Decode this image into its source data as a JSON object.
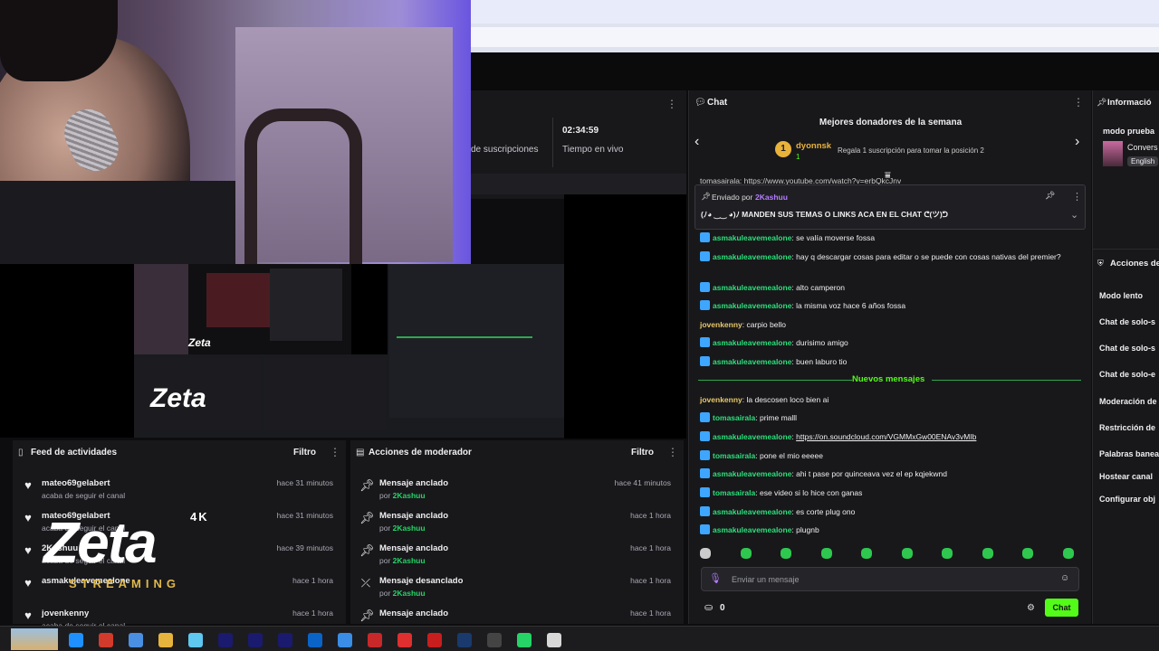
{
  "stats": {
    "subs_label": "de suscripciones",
    "live_time": "02:34:59",
    "live_label": "Tiempo en vivo"
  },
  "feed": {
    "title": "Feed de actividades",
    "filter": "Filtro",
    "items": [
      {
        "name": "mateo69gelabert",
        "sub": "acaba de seguir el canal",
        "time": "hace 31 minutos"
      },
      {
        "name": "mateo69gelabert",
        "sub": "acaba de seguir el canal",
        "time": "hace 31 minutos"
      },
      {
        "name": "2Kashuu",
        "sub": "acaba de seguir el canal",
        "time": "hace 39 minutos"
      },
      {
        "name": "asmakuleavemealone",
        "sub": "",
        "time": "hace 1 hora"
      },
      {
        "name": "jovenkenny",
        "sub": "acaba de seguir el canal",
        "time": "hace 1 hora"
      }
    ]
  },
  "mod": {
    "title": "Acciones de moderador",
    "filter": "Filtro",
    "items": [
      {
        "action": "Mensaje anclado",
        "by": "por",
        "user": "2Kashuu",
        "time": "hace 41 minutos"
      },
      {
        "action": "Mensaje anclado",
        "by": "por",
        "user": "2Kashuu",
        "time": "hace 1 hora"
      },
      {
        "action": "Mensaje anclado",
        "by": "por",
        "user": "2Kashuu",
        "time": "hace 1 hora"
      },
      {
        "action": "Mensaje desanclado",
        "by": "por",
        "user": "2Kashuu",
        "time": "hace 1 hora"
      },
      {
        "action": "Mensaje anclado",
        "by": "por",
        "user": "2Kashuu",
        "time": "hace 1 hora"
      }
    ]
  },
  "chat": {
    "title": "Chat",
    "donors_title": "Mejores donadores de la semana",
    "donor_rank": "1",
    "donor_name": "dyonnsk",
    "donor_amount": "1",
    "gift_text": "Regala 1 suscripción para tomar la posición 2",
    "top_link": "tomasairala: https://www.youtube.com/watch?v=erbQkcJnv",
    "pinned_by": "Enviado por",
    "pinned_user": "2Kashuu",
    "pinned_text": "(ﾉ◕ ‿‿ ◕)ﾉ MANDEN SUS TEMAS O LINKS ACA EN EL CHAT ᕦ(ツ)ᕤ",
    "messages": [
      {
        "user": "asmakuleavemealone",
        "text": ": se valía moverse fossa",
        "badge": true,
        "color": "green"
      },
      {
        "user": "asmakuleavemealone",
        "text": ": hay q descargar cosas para editar o se puede con cosas nativas del premier?",
        "badge": true,
        "color": "green"
      },
      {
        "user": "asmakuleavemealone",
        "text": ": alto camperon",
        "badge": true,
        "color": "green"
      },
      {
        "user": "asmakuleavemealone",
        "text": ": la misma voz hace 6 años fossa",
        "badge": true,
        "color": "green"
      },
      {
        "user": "jovenkenny",
        "text": ": carpio bello",
        "badge": false,
        "color": "yellow"
      },
      {
        "user": "asmakuleavemealone",
        "text": ": durisimo amigo",
        "badge": true,
        "color": "green"
      },
      {
        "user": "asmakuleavemealone",
        "text": ": buen laburo tio",
        "badge": true,
        "color": "green"
      }
    ],
    "new_messages": "Nuevos mensajes",
    "new": [
      {
        "user": "jovenkenny",
        "text": ": la descosen loco bien ai",
        "badge": false,
        "color": "yellow"
      },
      {
        "user": "tomasairala",
        "text": ": prime malll",
        "badge": true,
        "color": "green"
      },
      {
        "user": "asmakuleavemealone",
        "text": ": ",
        "link": "https://on.soundcloud.com/VGMMxGw00ENAv3vMIb",
        "badge": true,
        "color": "green"
      },
      {
        "user": "tomasairala",
        "text": ": pone el mio eeeee",
        "badge": true,
        "color": "green"
      },
      {
        "user": "asmakuleavemealone",
        "text": ": ahi t pase por quinceava vez el ep kqjekwnd",
        "badge": true,
        "color": "green"
      },
      {
        "user": "tomasairala",
        "text": ": ese video si lo hice con ganas",
        "badge": true,
        "color": "green"
      },
      {
        "user": "asmakuleavemealone",
        "text": ": es corte plug ono",
        "badge": true,
        "color": "green"
      },
      {
        "user": "asmakuleavemealone",
        "text": ": plugnb",
        "badge": true,
        "color": "green"
      }
    ],
    "input_placeholder": "Enviar un mensaje",
    "points": "0",
    "send": "Chat"
  },
  "info": {
    "title": "Informació",
    "mode": "modo prueba",
    "conv": "Convers",
    "lang": "English"
  },
  "actions": {
    "title": "Acciones de",
    "items": [
      "Modo lento",
      "Chat de solo-s",
      "Chat de solo-s",
      "Chat de solo-e",
      "Moderación de",
      "Restricción de",
      "Palabras banea",
      "Hostear canal",
      "Configurar obj"
    ]
  },
  "logo": {
    "word": "Zeta",
    "sub": "STREAMING",
    "tag": "4K"
  },
  "colors": {
    "accent": "#53fc18",
    "green_user": "#2be07a",
    "panel": "#18181b"
  }
}
